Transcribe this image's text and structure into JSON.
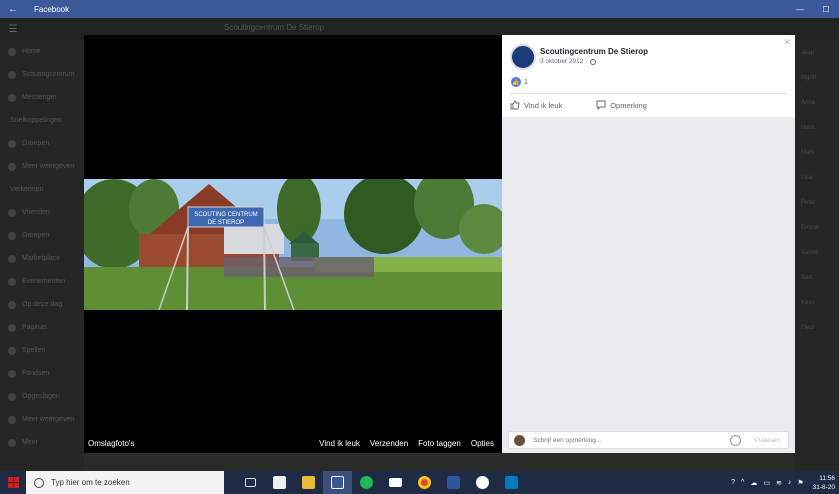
{
  "window": {
    "title": "Facebook"
  },
  "background": {
    "search_placeholder": "Scoutingcentrum De Stierop",
    "sidebar_items": [
      "Home",
      "Scoutingcentrum",
      "Messenger",
      "Snelkoppelingen",
      "Groepen",
      "Meer weergeven",
      "Verkennen",
      "Vrienden",
      "Groepen",
      "Marketplace",
      "Evenementen",
      "Op deze dag",
      "Paginas",
      "Spellen",
      "Fondsen",
      "Opgeslagen",
      "Meer weergeven",
      "Meer"
    ],
    "right_items": [
      "Jaap",
      "Ingrid",
      "Anna",
      "Henk",
      "Mark",
      "Lisa",
      "Peter",
      "Emma",
      "Sanne",
      "Bart",
      "Kees",
      "Fleur"
    ]
  },
  "viewer": {
    "caption": "Omslagfoto's",
    "actions": [
      "Vind ik leuk",
      "Verzenden",
      "Foto taggen",
      "Opties"
    ],
    "sign_line1": "SCOUTING CENTRUM",
    "sign_line2": "DE STIEROP"
  },
  "post": {
    "page_name": "Scoutingcentrum De Stierop",
    "date": "3 oktober 2012 ·",
    "like_count": "1",
    "like_label": "Vind ik leuk",
    "comment_label": "Opmerking",
    "comment_placeholder": "Schrijf een opmerking...",
    "post_button": "Plaatsen",
    "close": "✕"
  },
  "taskbar": {
    "search_placeholder": "Typ hier om te zoeken",
    "time": "11:56",
    "date": "31-8-20"
  }
}
